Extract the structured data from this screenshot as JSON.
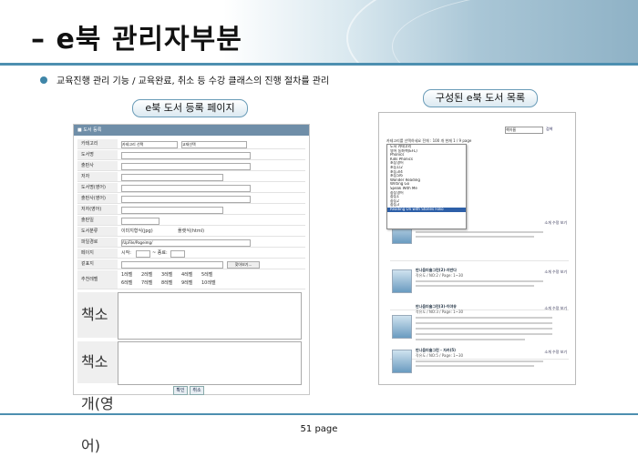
{
  "slide": {
    "title": "– e북 관리자부분",
    "description": "교육진행 관리 기능 / 교육완료, 취소 등 수강 클래스의 진행 절차를 관리",
    "label_left": "e북 도서 등록 페이지",
    "label_right": "구성된 e북 도서 목록",
    "page_number": "51 page"
  },
  "form": {
    "header": "■ 도서 등록",
    "labels": {
      "category": "카테고리",
      "title": "도서명",
      "publisher": "출판사",
      "author": "저자",
      "title_en": "도서명(영어)",
      "publisher_en": "출판사(영어)",
      "author_en": "저자(영어)",
      "pub_date": "출판일",
      "type": "도서분류",
      "folder": "파일경로",
      "pages": "페이지",
      "cover": "겉표지",
      "level": "추천레벨",
      "summary": "책소개",
      "summary_en": "책소개(영어)"
    },
    "category_select": "카테고리 선택",
    "subcategory_select": "교재선택",
    "type_option1": "이미지형식(jpg)",
    "type_option2": "플랫식(html)",
    "folder_value": "/UpFile/Pageimg/",
    "pages_start": "시작:",
    "pages_end": "~ 종료:",
    "browse": "찾아보기...",
    "levels": [
      "1레벨",
      "2레벨",
      "3레벨",
      "4레벨",
      "5레벨",
      "6레벨",
      "7레벨",
      "8레벨",
      "9레벨",
      "10레벨"
    ],
    "confirm": "확인",
    "cancel": "취소"
  },
  "list": {
    "search_value": "책이름",
    "search_go": "검색",
    "bar": "카테고리를 선택하세요   전체 : 100 개   현재 1 / 9 page",
    "tree_items": [
      "도서 카테고리",
      "영어 동화책(EFL)",
      "Phonics",
      "Kids Phonics",
      "초등영어",
      "초등1/2",
      "초등3/4",
      "초등5/6",
      "Wonder Reading",
      "Writing Go",
      "Speak With Me",
      "중등영어",
      "중등1",
      "중등2",
      "중등3",
      "Reading On with Stories Folio"
    ],
    "items": [
      {
        "title": "만나음미술그린 - 목유(1)",
        "meta": "작유도 / NO:1 / Page: 1~30"
      },
      {
        "title": "만나음미술그린(2)-지반다",
        "meta": "작유도 / NO:2 / Page: 1~30"
      },
      {
        "title": "만나음미술그린(3)-이야유",
        "meta": "작유도 / NO:3 / Page: 1~30"
      },
      {
        "title": "만나음미술그린 - 자카(5)",
        "meta": "작유도 / NO:5 / Page: 1~30"
      }
    ],
    "item_buttons": "소개  수정  보기"
  }
}
